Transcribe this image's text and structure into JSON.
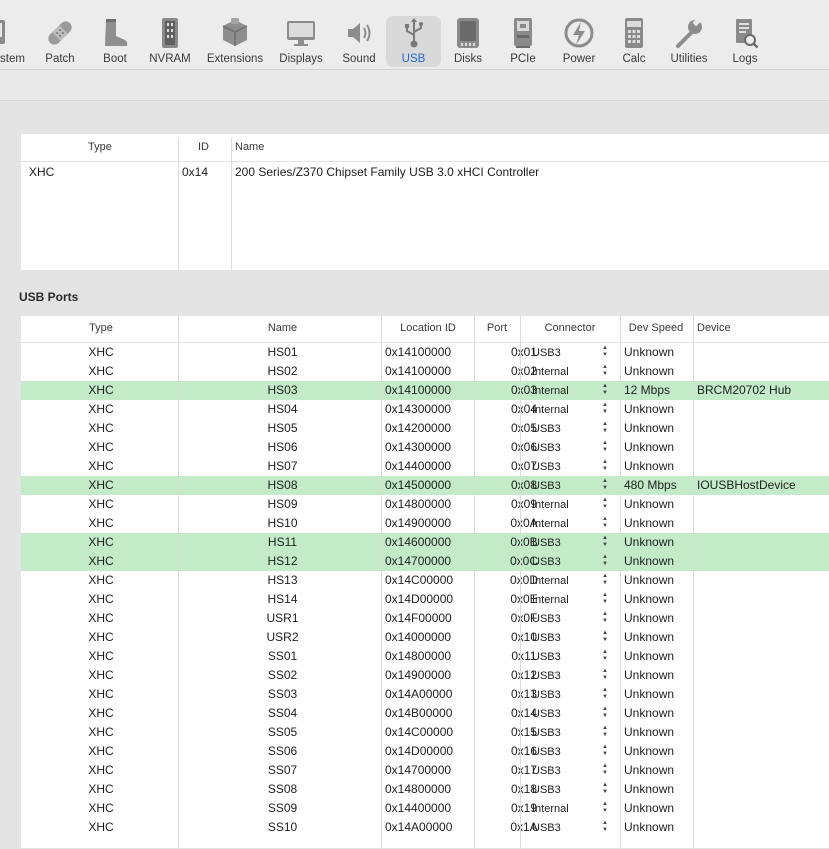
{
  "toolbar": {
    "items": [
      {
        "label": "stem",
        "icon": "system-icon"
      },
      {
        "label": "Patch",
        "icon": "bandage-icon"
      },
      {
        "label": "Boot",
        "icon": "boot-icon"
      },
      {
        "label": "NVRAM",
        "icon": "nvram-chip-icon"
      },
      {
        "label": "Extensions",
        "icon": "extensions-box-icon"
      },
      {
        "label": "Displays",
        "icon": "display-icon"
      },
      {
        "label": "Sound",
        "icon": "speaker-icon"
      },
      {
        "label": "USB",
        "icon": "usb-icon"
      },
      {
        "label": "Disks",
        "icon": "disk-icon"
      },
      {
        "label": "PCIe",
        "icon": "pcie-card-icon"
      },
      {
        "label": "Power",
        "icon": "power-bolt-icon"
      },
      {
        "label": "Calc",
        "icon": "calculator-icon"
      },
      {
        "label": "Utilities",
        "icon": "tools-icon"
      },
      {
        "label": "Logs",
        "icon": "logs-icon"
      }
    ],
    "active": "USB",
    "accent": "#2466d8"
  },
  "controllers": {
    "headers": {
      "type": "Type",
      "id": "ID",
      "name": "Name"
    },
    "rows": [
      {
        "type": "XHC",
        "id": "0x14",
        "name": "200 Series/Z370 Chipset Family USB 3.0 xHCI Controller"
      }
    ]
  },
  "ports": {
    "title": "USB Ports",
    "highlight_color": "#c3ebc8",
    "headers": {
      "type": "Type",
      "name": "Name",
      "location": "Location ID",
      "port": "Port",
      "connector": "Connector",
      "speed": "Dev Speed",
      "device": "Device"
    },
    "rows": [
      {
        "type": "XHC",
        "name": "HS01",
        "location": "0x14100000",
        "port": "0x01",
        "connector": "USB3",
        "speed": "Unknown",
        "device": "",
        "highlight": false
      },
      {
        "type": "XHC",
        "name": "HS02",
        "location": "0x14100000",
        "port": "0x02",
        "connector": "Internal",
        "speed": "Unknown",
        "device": "",
        "highlight": false
      },
      {
        "type": "XHC",
        "name": "HS03",
        "location": "0x14100000",
        "port": "0x03",
        "connector": "Internal",
        "speed": "12 Mbps",
        "device": "BRCM20702 Hub",
        "highlight": true
      },
      {
        "type": "XHC",
        "name": "HS04",
        "location": "0x14300000",
        "port": "0x04",
        "connector": "Internal",
        "speed": "Unknown",
        "device": "",
        "highlight": false
      },
      {
        "type": "XHC",
        "name": "HS05",
        "location": "0x14200000",
        "port": "0x05",
        "connector": "USB3",
        "speed": "Unknown",
        "device": "",
        "highlight": false
      },
      {
        "type": "XHC",
        "name": "HS06",
        "location": "0x14300000",
        "port": "0x06",
        "connector": "USB3",
        "speed": "Unknown",
        "device": "",
        "highlight": false
      },
      {
        "type": "XHC",
        "name": "HS07",
        "location": "0x14400000",
        "port": "0x07",
        "connector": "USB3",
        "speed": "Unknown",
        "device": "",
        "highlight": false
      },
      {
        "type": "XHC",
        "name": "HS08",
        "location": "0x14500000",
        "port": "0x08",
        "connector": "USB3",
        "speed": "480 Mbps",
        "device": "IOUSBHostDevice",
        "highlight": true
      },
      {
        "type": "XHC",
        "name": "HS09",
        "location": "0x14800000",
        "port": "0x09",
        "connector": "Internal",
        "speed": "Unknown",
        "device": "",
        "highlight": false
      },
      {
        "type": "XHC",
        "name": "HS10",
        "location": "0x14900000",
        "port": "0x0A",
        "connector": "Internal",
        "speed": "Unknown",
        "device": "",
        "highlight": false
      },
      {
        "type": "XHC",
        "name": "HS11",
        "location": "0x14600000",
        "port": "0x0B",
        "connector": "USB3",
        "speed": "Unknown",
        "device": "",
        "highlight": true
      },
      {
        "type": "XHC",
        "name": "HS12",
        "location": "0x14700000",
        "port": "0x0C",
        "connector": "USB3",
        "speed": "Unknown",
        "device": "",
        "highlight": true
      },
      {
        "type": "XHC",
        "name": "HS13",
        "location": "0x14C00000",
        "port": "0x0D",
        "connector": "Internal",
        "speed": "Unknown",
        "device": "",
        "highlight": false
      },
      {
        "type": "XHC",
        "name": "HS14",
        "location": "0x14D00000",
        "port": "0x0E",
        "connector": "Internal",
        "speed": "Unknown",
        "device": "",
        "highlight": false
      },
      {
        "type": "XHC",
        "name": "USR1",
        "location": "0x14F00000",
        "port": "0x0F",
        "connector": "USB3",
        "speed": "Unknown",
        "device": "",
        "highlight": false
      },
      {
        "type": "XHC",
        "name": "USR2",
        "location": "0x14000000",
        "port": "0x10",
        "connector": "USB3",
        "speed": "Unknown",
        "device": "",
        "highlight": false
      },
      {
        "type": "XHC",
        "name": "SS01",
        "location": "0x14800000",
        "port": "0x11",
        "connector": "USB3",
        "speed": "Unknown",
        "device": "",
        "highlight": false
      },
      {
        "type": "XHC",
        "name": "SS02",
        "location": "0x14900000",
        "port": "0x12",
        "connector": "USB3",
        "speed": "Unknown",
        "device": "",
        "highlight": false
      },
      {
        "type": "XHC",
        "name": "SS03",
        "location": "0x14A00000",
        "port": "0x13",
        "connector": "USB3",
        "speed": "Unknown",
        "device": "",
        "highlight": false
      },
      {
        "type": "XHC",
        "name": "SS04",
        "location": "0x14B00000",
        "port": "0x14",
        "connector": "USB3",
        "speed": "Unknown",
        "device": "",
        "highlight": false
      },
      {
        "type": "XHC",
        "name": "SS05",
        "location": "0x14C00000",
        "port": "0x15",
        "connector": "USB3",
        "speed": "Unknown",
        "device": "",
        "highlight": false
      },
      {
        "type": "XHC",
        "name": "SS06",
        "location": "0x14D00000",
        "port": "0x16",
        "connector": "USB3",
        "speed": "Unknown",
        "device": "",
        "highlight": false
      },
      {
        "type": "XHC",
        "name": "SS07",
        "location": "0x14700000",
        "port": "0x17",
        "connector": "USB3",
        "speed": "Unknown",
        "device": "",
        "highlight": false
      },
      {
        "type": "XHC",
        "name": "SS08",
        "location": "0x14800000",
        "port": "0x18",
        "connector": "USB3",
        "speed": "Unknown",
        "device": "",
        "highlight": false
      },
      {
        "type": "XHC",
        "name": "SS09",
        "location": "0x14400000",
        "port": "0x19",
        "connector": "Internal",
        "speed": "Unknown",
        "device": "",
        "highlight": false
      },
      {
        "type": "XHC",
        "name": "SS10",
        "location": "0x14A00000",
        "port": "0x1A",
        "connector": "USB3",
        "speed": "Unknown",
        "device": "",
        "highlight": false
      }
    ]
  }
}
